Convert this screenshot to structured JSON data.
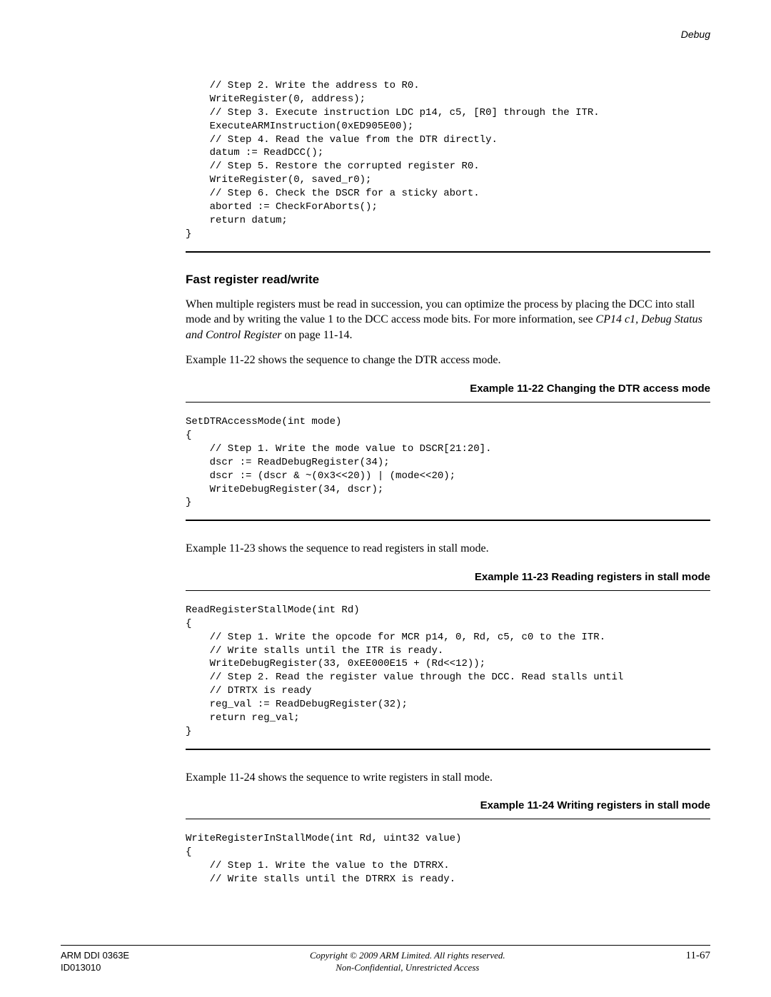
{
  "header": {
    "section": "Debug"
  },
  "blocks": {
    "code1": "    // Step 2. Write the address to R0.\n    WriteRegister(0, address);\n    // Step 3. Execute instruction LDC p14, c5, [R0] through the ITR.\n    ExecuteARMInstruction(0xED905E00);\n    // Step 4. Read the value from the DTR directly.\n    datum := ReadDCC();\n    // Step 5. Restore the corrupted register R0.\n    WriteRegister(0, saved_r0);\n    // Step 6. Check the DSCR for a sticky abort.\n    aborted := CheckForAborts();\n    return datum;\n}",
    "heading1": "Fast register read/write",
    "para1a": "When multiple registers must be read in succession, you can optimize the process by placing the DCC into stall mode and by writing the value 1 to the DCC access mode bits. For more information, see ",
    "para1b": "CP14 c1, Debug Status and Control Register",
    "para1c": " on page 11-14.",
    "para2": "Example 11-22 shows the sequence to change the DTR access mode.",
    "caption1": "Example 11-22 Changing the DTR access mode",
    "code2": "SetDTRAccessMode(int mode)\n{\n    // Step 1. Write the mode value to DSCR[21:20].\n    dscr := ReadDebugRegister(34);\n    dscr := (dscr & ~(0x3<<20)) | (mode<<20);\n    WriteDebugRegister(34, dscr);\n}",
    "para3": "Example 11-23 shows the sequence to read registers in stall mode.",
    "caption2": "Example 11-23 Reading registers in stall mode",
    "code3": "ReadRegisterStallMode(int Rd)\n{\n    // Step 1. Write the opcode for MCR p14, 0, Rd, c5, c0 to the ITR.\n    // Write stalls until the ITR is ready.\n    WriteDebugRegister(33, 0xEE000E15 + (Rd<<12));\n    // Step 2. Read the register value through the DCC. Read stalls until\n    // DTRTX is ready\n    reg_val := ReadDebugRegister(32);\n    return reg_val;\n}",
    "para4": "Example 11-24 shows the sequence to write registers in stall mode.",
    "caption3": "Example 11-24 Writing registers in stall mode",
    "code4": "WriteRegisterInStallMode(int Rd, uint32 value)\n{\n    // Step 1. Write the value to the DTRRX.\n    // Write stalls until the DTRRX is ready."
  },
  "footer": {
    "left1": "ARM DDI 0363E",
    "left2": "ID013010",
    "center1": "Copyright © 2009 ARM Limited. All rights reserved.",
    "center2": "Non-Confidential, Unrestricted Access",
    "right": "11-67"
  }
}
